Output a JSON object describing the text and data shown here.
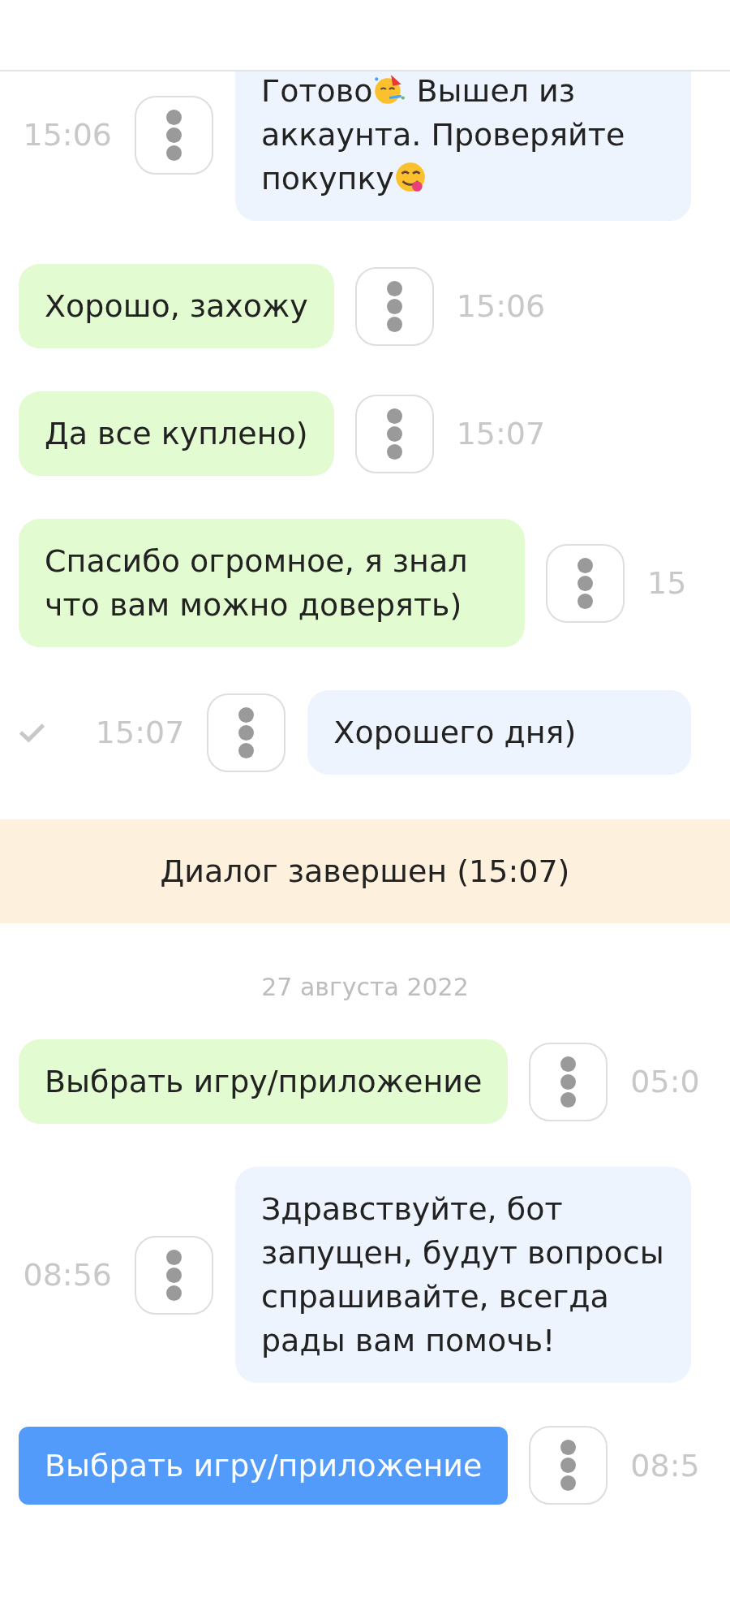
{
  "feed": [
    {
      "kind": "outgoing",
      "segments": [
        {
          "kind": "text",
          "text": "Готово"
        },
        {
          "kind": "party_emoji"
        },
        {
          "kind": "text",
          "text": " Вышел из аккаунта. Проверяйте покупку"
        },
        {
          "kind": "yum_emoji"
        }
      ],
      "time": "15:06",
      "tick": false
    },
    {
      "kind": "incoming",
      "segments": [
        {
          "kind": "text",
          "text": "Хорошо, захожу"
        }
      ],
      "time": "15:06"
    },
    {
      "kind": "incoming",
      "segments": [
        {
          "kind": "text",
          "text": "Да все куплено)"
        }
      ],
      "time": "15:07"
    },
    {
      "kind": "incoming",
      "segments": [
        {
          "kind": "text",
          "text": "Спасибо огромное, я знал что вам можно доверять)"
        }
      ],
      "time": "15"
    },
    {
      "kind": "outgoing",
      "segments": [
        {
          "kind": "text",
          "text": "Хорошего дня)"
        }
      ],
      "time": "15:07",
      "tick": true
    },
    {
      "kind": "banner",
      "text": "Диалог завершен (15:07)"
    },
    {
      "kind": "date",
      "text": "27 августа 2022"
    },
    {
      "kind": "incoming",
      "segments": [
        {
          "kind": "text",
          "text": "Выбрать игру/приложение"
        }
      ],
      "time": "05:0"
    },
    {
      "kind": "outgoing",
      "segments": [
        {
          "kind": "text",
          "text": "Здравствуйте, бот запущен, будут вопросы спрашивайте, всегда рады вам помочь!"
        }
      ],
      "time": "08:56",
      "tick": false
    },
    {
      "kind": "button",
      "text": "Выбрать игру/приложение",
      "time": "08:5"
    }
  ]
}
